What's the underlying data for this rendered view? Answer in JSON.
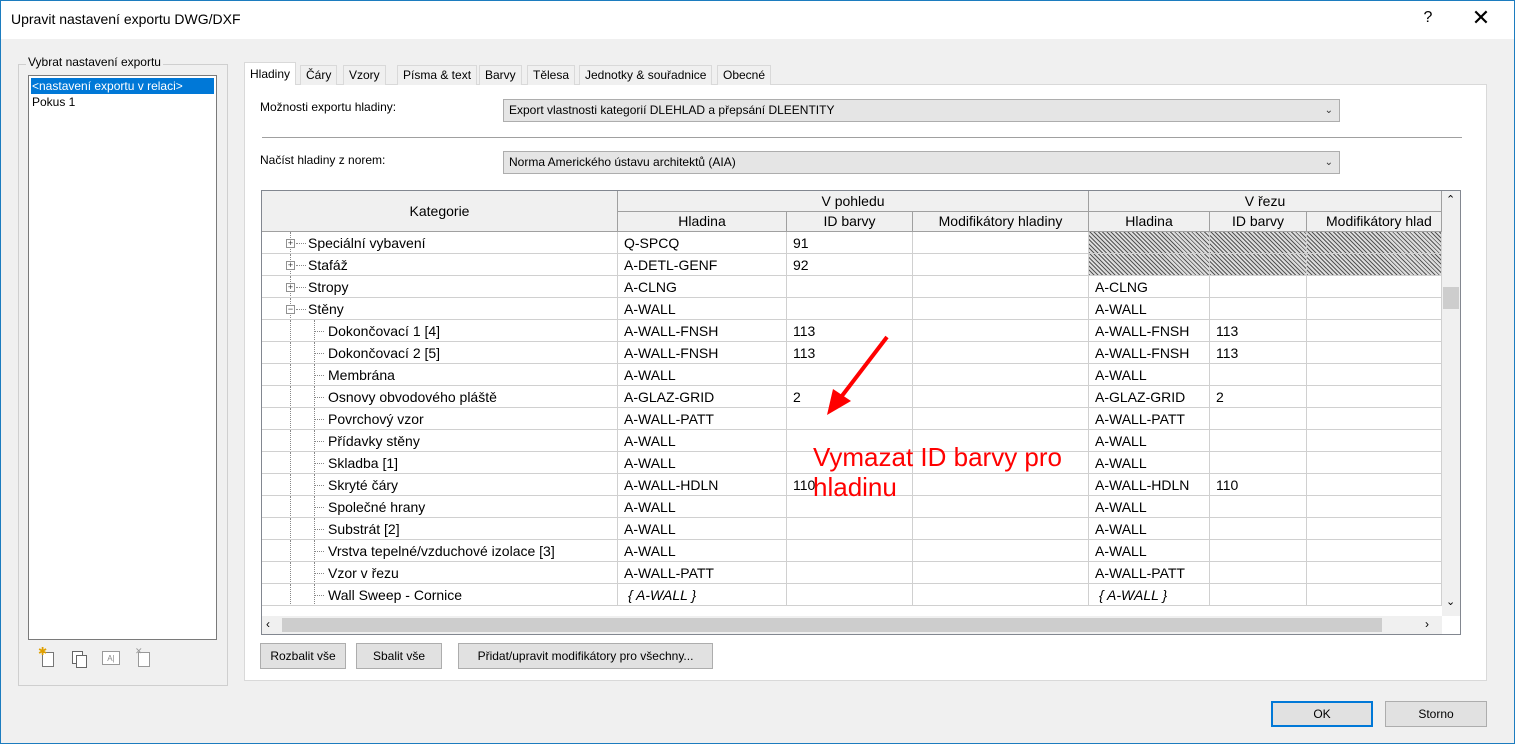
{
  "window": {
    "title": "Upravit nastavení exportu DWG/DXF",
    "help_label": "?",
    "close_label": "✕"
  },
  "left_panel": {
    "group_label": "Vybrat nastavení exportu",
    "items": [
      {
        "label": "<nastavení exportu v relaci>"
      },
      {
        "label": "Pokus 1"
      }
    ]
  },
  "tabs": [
    {
      "label": "Hladiny"
    },
    {
      "label": "Čáry"
    },
    {
      "label": "Vzory"
    },
    {
      "label": "Písma & text"
    },
    {
      "label": "Barvy"
    },
    {
      "label": "Tělesa"
    },
    {
      "label": "Jednotky & souřadnice"
    },
    {
      "label": "Obecné"
    }
  ],
  "layer_options": {
    "label": "Možnosti exportu hladiny:",
    "value": "Export vlastnosti kategorií DLEHLAD a přepsání DLEENTITY"
  },
  "load_layers": {
    "label": "Načíst hladiny z norem:",
    "value": "Norma Amerického ústavu architektů (AIA)"
  },
  "grid": {
    "header": {
      "category": "Kategorie",
      "group_view": "V pohledu",
      "group_cut": "V řezu",
      "layer": "Hladina",
      "color_id": "ID barvy",
      "modifiers": "Modifikátory hladiny",
      "modifiers_cut": "Modifikátory hlad"
    },
    "rows": [
      {
        "name": "Speciální vybavení",
        "level": 0,
        "exp": "+",
        "v_layer": "Q-SPCQ",
        "v_color": "91",
        "c_layer": "",
        "c_color": "",
        "hatch": true
      },
      {
        "name": "Stafáž",
        "level": 0,
        "exp": "+",
        "v_layer": "A-DETL-GENF",
        "v_color": "92",
        "c_layer": "",
        "c_color": "",
        "hatch": true
      },
      {
        "name": "Stropy",
        "level": 0,
        "exp": "+",
        "v_layer": "A-CLNG",
        "v_color": "",
        "c_layer": "A-CLNG",
        "c_color": ""
      },
      {
        "name": "Stěny",
        "level": 0,
        "exp": "−",
        "v_layer": "A-WALL",
        "v_color": "",
        "c_layer": "A-WALL",
        "c_color": ""
      },
      {
        "name": "Dokončovací 1 [4]",
        "level": 1,
        "v_layer": "A-WALL-FNSH",
        "v_color": "113",
        "c_layer": "A-WALL-FNSH",
        "c_color": "113"
      },
      {
        "name": "Dokončovací 2 [5]",
        "level": 1,
        "v_layer": "A-WALL-FNSH",
        "v_color": "113",
        "c_layer": "A-WALL-FNSH",
        "c_color": "113"
      },
      {
        "name": "Membrána",
        "level": 1,
        "v_layer": "A-WALL",
        "v_color": "",
        "c_layer": "A-WALL",
        "c_color": ""
      },
      {
        "name": "Osnovy obvodového pláště",
        "level": 1,
        "v_layer": "A-GLAZ-GRID",
        "v_color": "2",
        "c_layer": "A-GLAZ-GRID",
        "c_color": "2"
      },
      {
        "name": "Povrchový vzor",
        "level": 1,
        "v_layer": "A-WALL-PATT",
        "v_color": "",
        "c_layer": "A-WALL-PATT",
        "c_color": ""
      },
      {
        "name": "Přídavky stěny",
        "level": 1,
        "v_layer": "A-WALL",
        "v_color": "",
        "c_layer": "A-WALL",
        "c_color": ""
      },
      {
        "name": "Skladba [1]",
        "level": 1,
        "v_layer": "A-WALL",
        "v_color": "",
        "c_layer": "A-WALL",
        "c_color": ""
      },
      {
        "name": "Skryté čáry",
        "level": 1,
        "v_layer": "A-WALL-HDLN",
        "v_color": "110",
        "c_layer": "A-WALL-HDLN",
        "c_color": "110"
      },
      {
        "name": "Společné hrany",
        "level": 1,
        "v_layer": "A-WALL",
        "v_color": "",
        "c_layer": "A-WALL",
        "c_color": ""
      },
      {
        "name": "Substrát [2]",
        "level": 1,
        "v_layer": "A-WALL",
        "v_color": "",
        "c_layer": "A-WALL",
        "c_color": ""
      },
      {
        "name": "Vrstva tepelné/vzduchové izolace [3]",
        "level": 1,
        "v_layer": "A-WALL",
        "v_color": "",
        "c_layer": "A-WALL",
        "c_color": ""
      },
      {
        "name": "Vzor v řezu",
        "level": 1,
        "v_layer": "A-WALL-PATT",
        "v_color": "",
        "c_layer": "A-WALL-PATT",
        "c_color": ""
      },
      {
        "name": "Wall Sweep - Cornice",
        "level": 1,
        "v_layer": "{ A-WALL }",
        "v_color": "",
        "c_layer": "{ A-WALL }",
        "c_color": "",
        "italic": true
      }
    ]
  },
  "annotation": {
    "text": "Vymazat ID barvy pro hladinu",
    "color": "#ff0000"
  },
  "buttons": {
    "expand_all": "Rozbalit vše",
    "collapse_all": "Sbalit vše",
    "modifiers_all": "Přidat/upravit modifikátory pro všechny...",
    "ok": "OK",
    "cancel": "Storno"
  },
  "icons": [
    "new-setup-icon",
    "duplicate-setup-icon",
    "rename-setup-icon",
    "delete-setup-icon"
  ],
  "colors": {
    "accent": "#0078d7",
    "selection": "#0078d7",
    "annotation": "#ff0000"
  }
}
